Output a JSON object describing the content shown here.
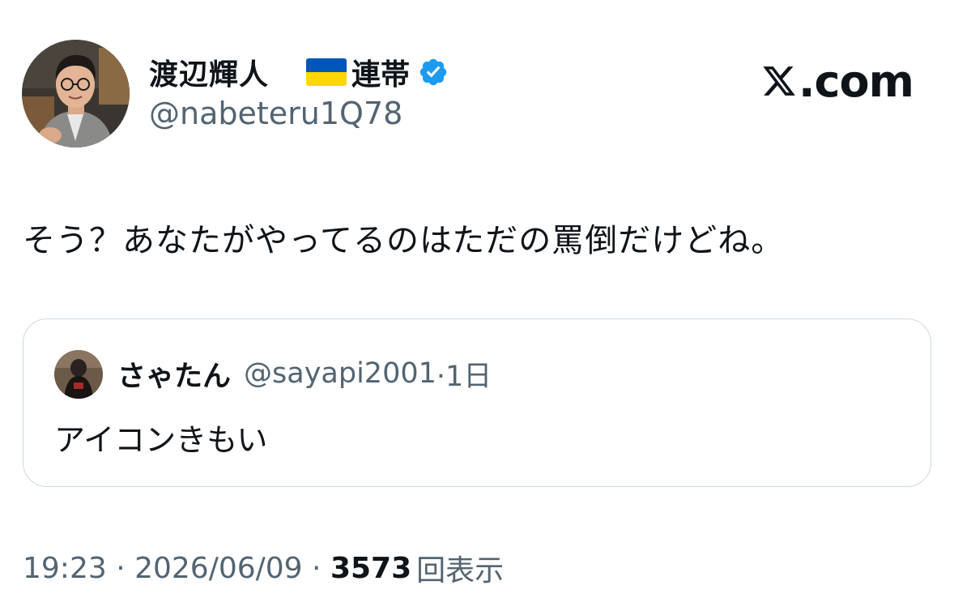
{
  "author": {
    "display_name": "渡辺輝人",
    "name_suffix": "連帯",
    "flag_icon": "ukraine-flag-icon",
    "verified_icon": "verified-badge-icon",
    "handle": "@nabeteru1Q78"
  },
  "brand": {
    "logo_text": ".com",
    "logo_icon": "x-logo-icon"
  },
  "tweet": {
    "text": "そう？あなたがやってるのはただの罵倒だけどね。"
  },
  "quote": {
    "display_name": "さゃたん",
    "handle": "@sayapi2001",
    "time": "·1日",
    "text": "アイコンきもい"
  },
  "meta": {
    "time": "19:23",
    "sep1": " · ",
    "date": "2026/06/09",
    "sep2": " · ",
    "views_count": "3573",
    "views_label": "回表示"
  },
  "colors": {
    "text_primary": "#0f1419",
    "text_secondary": "#536471",
    "verified_blue": "#1d9bf0",
    "border": "#cfd9de",
    "flag_blue": "#0057b7",
    "flag_yellow": "#ffd700"
  }
}
